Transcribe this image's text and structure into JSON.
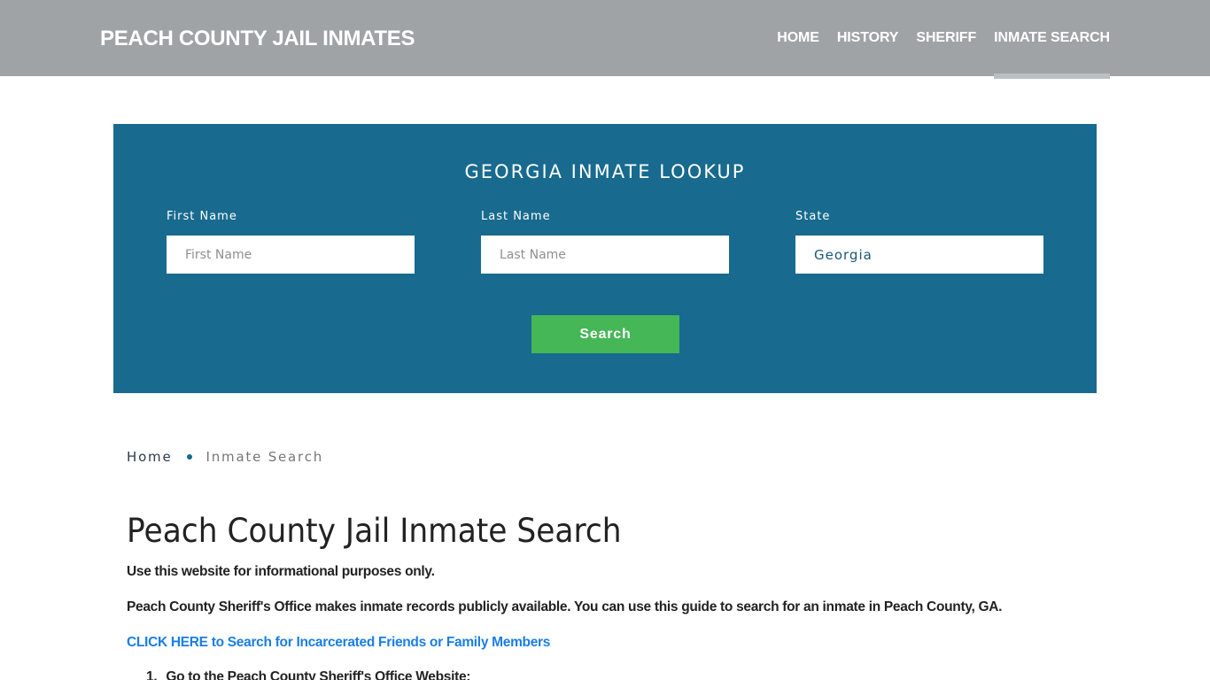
{
  "header": {
    "brand": "PEACH COUNTY JAIL INMATES",
    "nav": [
      {
        "label": "HOME",
        "active": false
      },
      {
        "label": "HISTORY",
        "active": false
      },
      {
        "label": "SHERIFF",
        "active": false
      },
      {
        "label": "INMATE SEARCH",
        "active": true
      }
    ]
  },
  "lookup": {
    "title": "GEORGIA INMATE LOOKUP",
    "first_name": {
      "label": "First Name",
      "placeholder": "First Name",
      "value": ""
    },
    "last_name": {
      "label": "Last Name",
      "placeholder": "Last Name",
      "value": ""
    },
    "state": {
      "label": "State",
      "value": "Georgia"
    },
    "search_label": "Search"
  },
  "breadcrumb": {
    "home": "Home",
    "current": "Inmate Search"
  },
  "content": {
    "title": "Peach County Jail Inmate Search",
    "paragraphs": [
      "Use this website for informational purposes only.",
      "Peach County Sheriff's Office makes inmate records publicly available. You can use this guide to search for an inmate in Peach County, GA."
    ],
    "link": "CLICK HERE to Search for Incarcerated Friends or Family Members",
    "steps": [
      {
        "num": "1.",
        "text": "Go to the Peach County Sheriff's Office Website:"
      }
    ]
  },
  "colors": {
    "header_bg": "#9fa3a6",
    "lookup_bg": "#186a8e",
    "search_button": "#45b757",
    "link": "#1a7ee6"
  }
}
